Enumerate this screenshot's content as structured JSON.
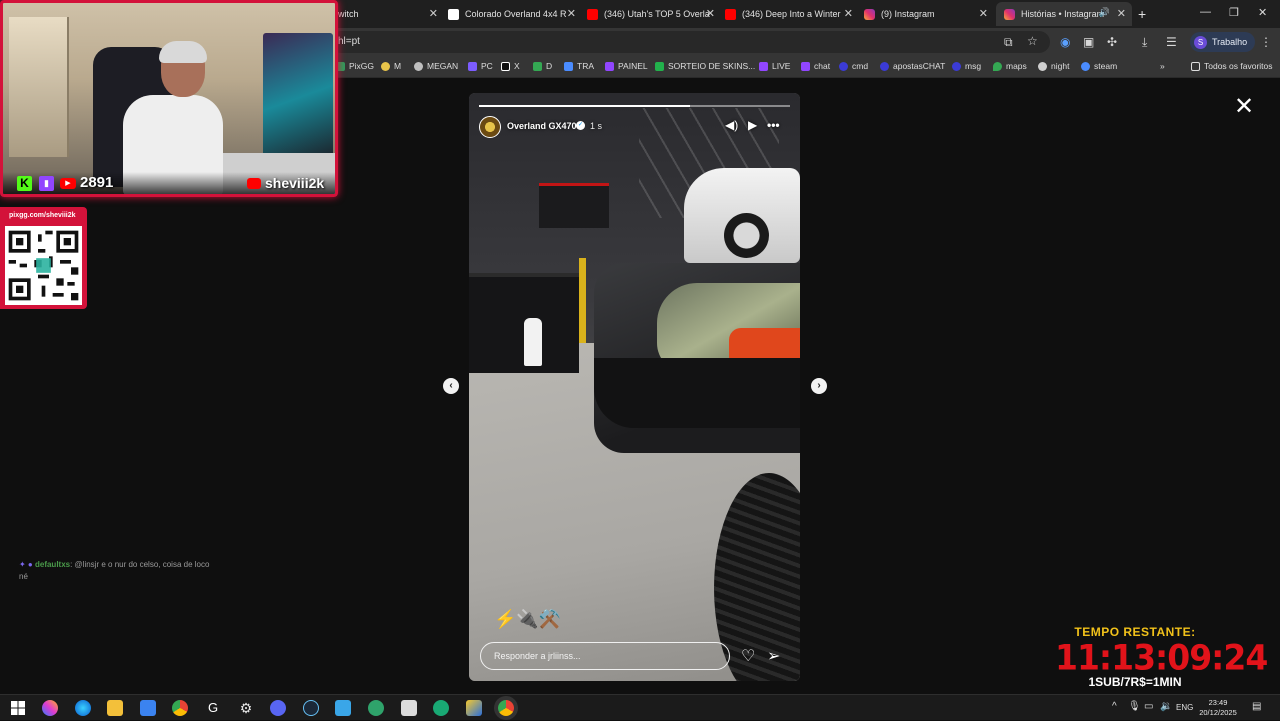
{
  "browser": {
    "tabs": [
      {
        "label": "witch",
        "favicon_color": "#9146ff",
        "active": false
      },
      {
        "label": "Colorado Overland 4x4 R",
        "favicon_color": "#ffffff",
        "active": false
      },
      {
        "label": "(346) Utah's TOP 5 Overla",
        "favicon_color": "#ff0000",
        "active": false
      },
      {
        "label": "(346) Deep Into a Winter",
        "favicon_color": "#ff0000",
        "active": false
      },
      {
        "label": "(9) Instagram",
        "favicon_color": "#e1306c",
        "active": false
      },
      {
        "label": "Histórias • Instagram",
        "favicon_color": "#e1306c",
        "active": true
      }
    ],
    "new_tab": "+",
    "url": "hl=pt",
    "profile": {
      "initial": "S",
      "label": "Trabalho"
    },
    "bookmarks": [
      {
        "label": "PixGG",
        "color": "#2b9d5c"
      },
      {
        "label": "M",
        "color": "#e8c44a"
      },
      {
        "label": "MEGAN",
        "color": "#bfbfbf"
      },
      {
        "label": "PC",
        "color": "#7c5cff"
      },
      {
        "label": "X",
        "color": "#ffffff"
      },
      {
        "label": "D",
        "color": "#34a853"
      },
      {
        "label": "TRA",
        "color": "#4a8cff"
      },
      {
        "label": "PAINEL",
        "color": "#9146ff"
      },
      {
        "label": "SORTEIO DE SKINS...",
        "color": "#22b14c"
      },
      {
        "label": "LIVE",
        "color": "#9146ff"
      },
      {
        "label": "chat",
        "color": "#9146ff"
      },
      {
        "label": "cmd",
        "color": "#3b3bd6"
      },
      {
        "label": "apostasCHAT",
        "color": "#3b3bd6"
      },
      {
        "label": "msg",
        "color": "#3b3bd6"
      },
      {
        "label": "maps",
        "color": "#34a853"
      },
      {
        "label": "night",
        "color": "#cfcfcf"
      },
      {
        "label": "steam",
        "color": "#4a8cff"
      }
    ],
    "all_bookmarks": "Todos os favoritos"
  },
  "webcam": {
    "viewer_count": "2891",
    "channel_name": "sheviii2k",
    "kick_letter": "K"
  },
  "qr": {
    "label": "pixgg.com/sheviii2k"
  },
  "chat": {
    "username": "defaultxs",
    "message": ": @linsjr e o nur do celso, coisa de loco né"
  },
  "story": {
    "username": "Overland GX470",
    "time": "1 s",
    "progress": 0.68,
    "emojis": "⚡🔌⚒️",
    "reply_placeholder": "Responder a jrliinss..."
  },
  "timer": {
    "label": "TEMPO RESTANTE:",
    "value": "11:13:09:24",
    "rate": "1SUB/7R$=1MIN"
  },
  "taskbar": {
    "clock_time": "23:49",
    "clock_date": "20/12/2025",
    "lang": "ENG"
  },
  "colors": {
    "stream_frame": "#d3123a",
    "timer_label": "#f2c21a",
    "timer_value": "#e1131a"
  }
}
